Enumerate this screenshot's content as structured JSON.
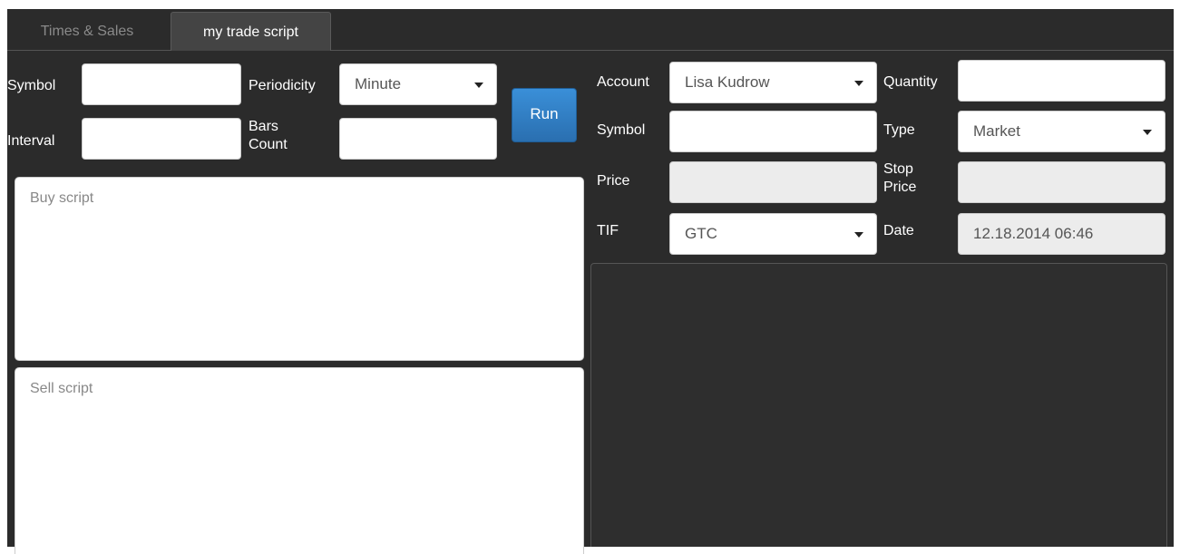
{
  "tabs": [
    {
      "label": "Times & Sales"
    },
    {
      "label": "my trade script"
    }
  ],
  "left": {
    "symbol_label": "Symbol",
    "symbol_value": "",
    "periodicity_label": "Periodicity",
    "periodicity_value": "Minute",
    "interval_label": "Interval",
    "interval_value": "",
    "bars_count_label": "Bars\nCount",
    "bars_count_value": "",
    "run_label": "Run",
    "buy_placeholder": "Buy script",
    "sell_placeholder": "Sell script"
  },
  "right": {
    "account_label": "Account",
    "account_value": "Lisa Kudrow",
    "quantity_label": "Quantity",
    "quantity_value": "",
    "symbol_label": "Symbol",
    "symbol_value": "",
    "type_label": "Type",
    "type_value": "Market",
    "price_label": "Price",
    "price_value": "",
    "stop_price_label": "Stop\nPrice",
    "stop_price_value": "",
    "tif_label": "TIF",
    "tif_value": "GTC",
    "date_label": "Date",
    "date_value": "12.18.2014 06:46"
  },
  "colors": {
    "background": "#2b2b2b",
    "active_tab": "#444444",
    "run_button": "#2f7cc4"
  }
}
